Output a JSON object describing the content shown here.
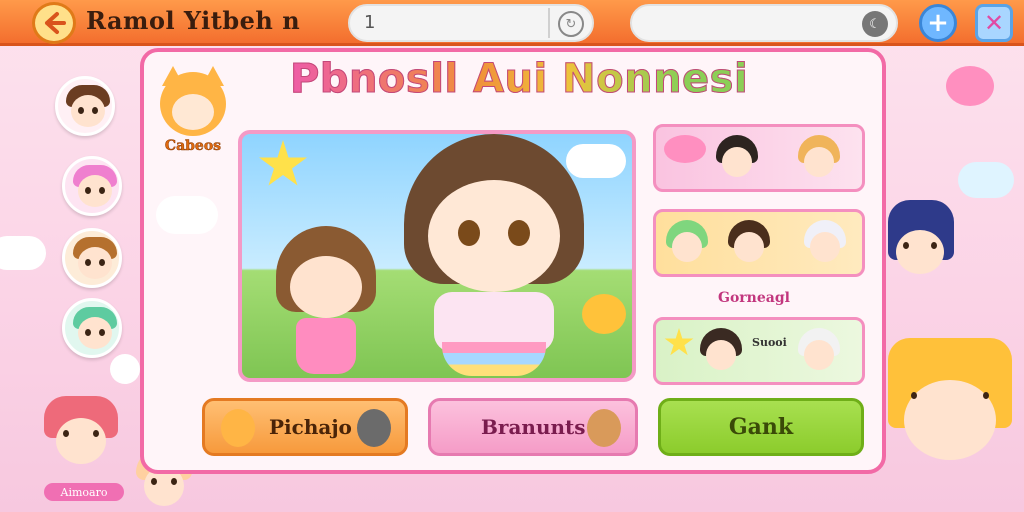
{
  "header": {
    "title": "Ramol Yitbeh n",
    "search1_value": "1",
    "search2_value": ""
  },
  "panel": {
    "title": "Pbnosll Aui Nonnesi",
    "badge_label": "Cabeos",
    "card_caption": "Gorneagl",
    "card3_label": "Suooi"
  },
  "buttons": {
    "left": "Pichajo",
    "middle": "Branunts",
    "right": "Gank"
  },
  "left_nameplate": "Aimoaro",
  "icons": {
    "back": "back-arrow-icon",
    "search1": "refresh-icon",
    "search2": "moon-icon",
    "plus": "plus-icon",
    "close": "close-icon"
  },
  "colors": {
    "topbar": "#f36e2e",
    "panel_border": "#f26aa6",
    "btn_orange": "#f79a3c",
    "btn_pink": "#f59cc7",
    "btn_green": "#8ccc2c"
  }
}
